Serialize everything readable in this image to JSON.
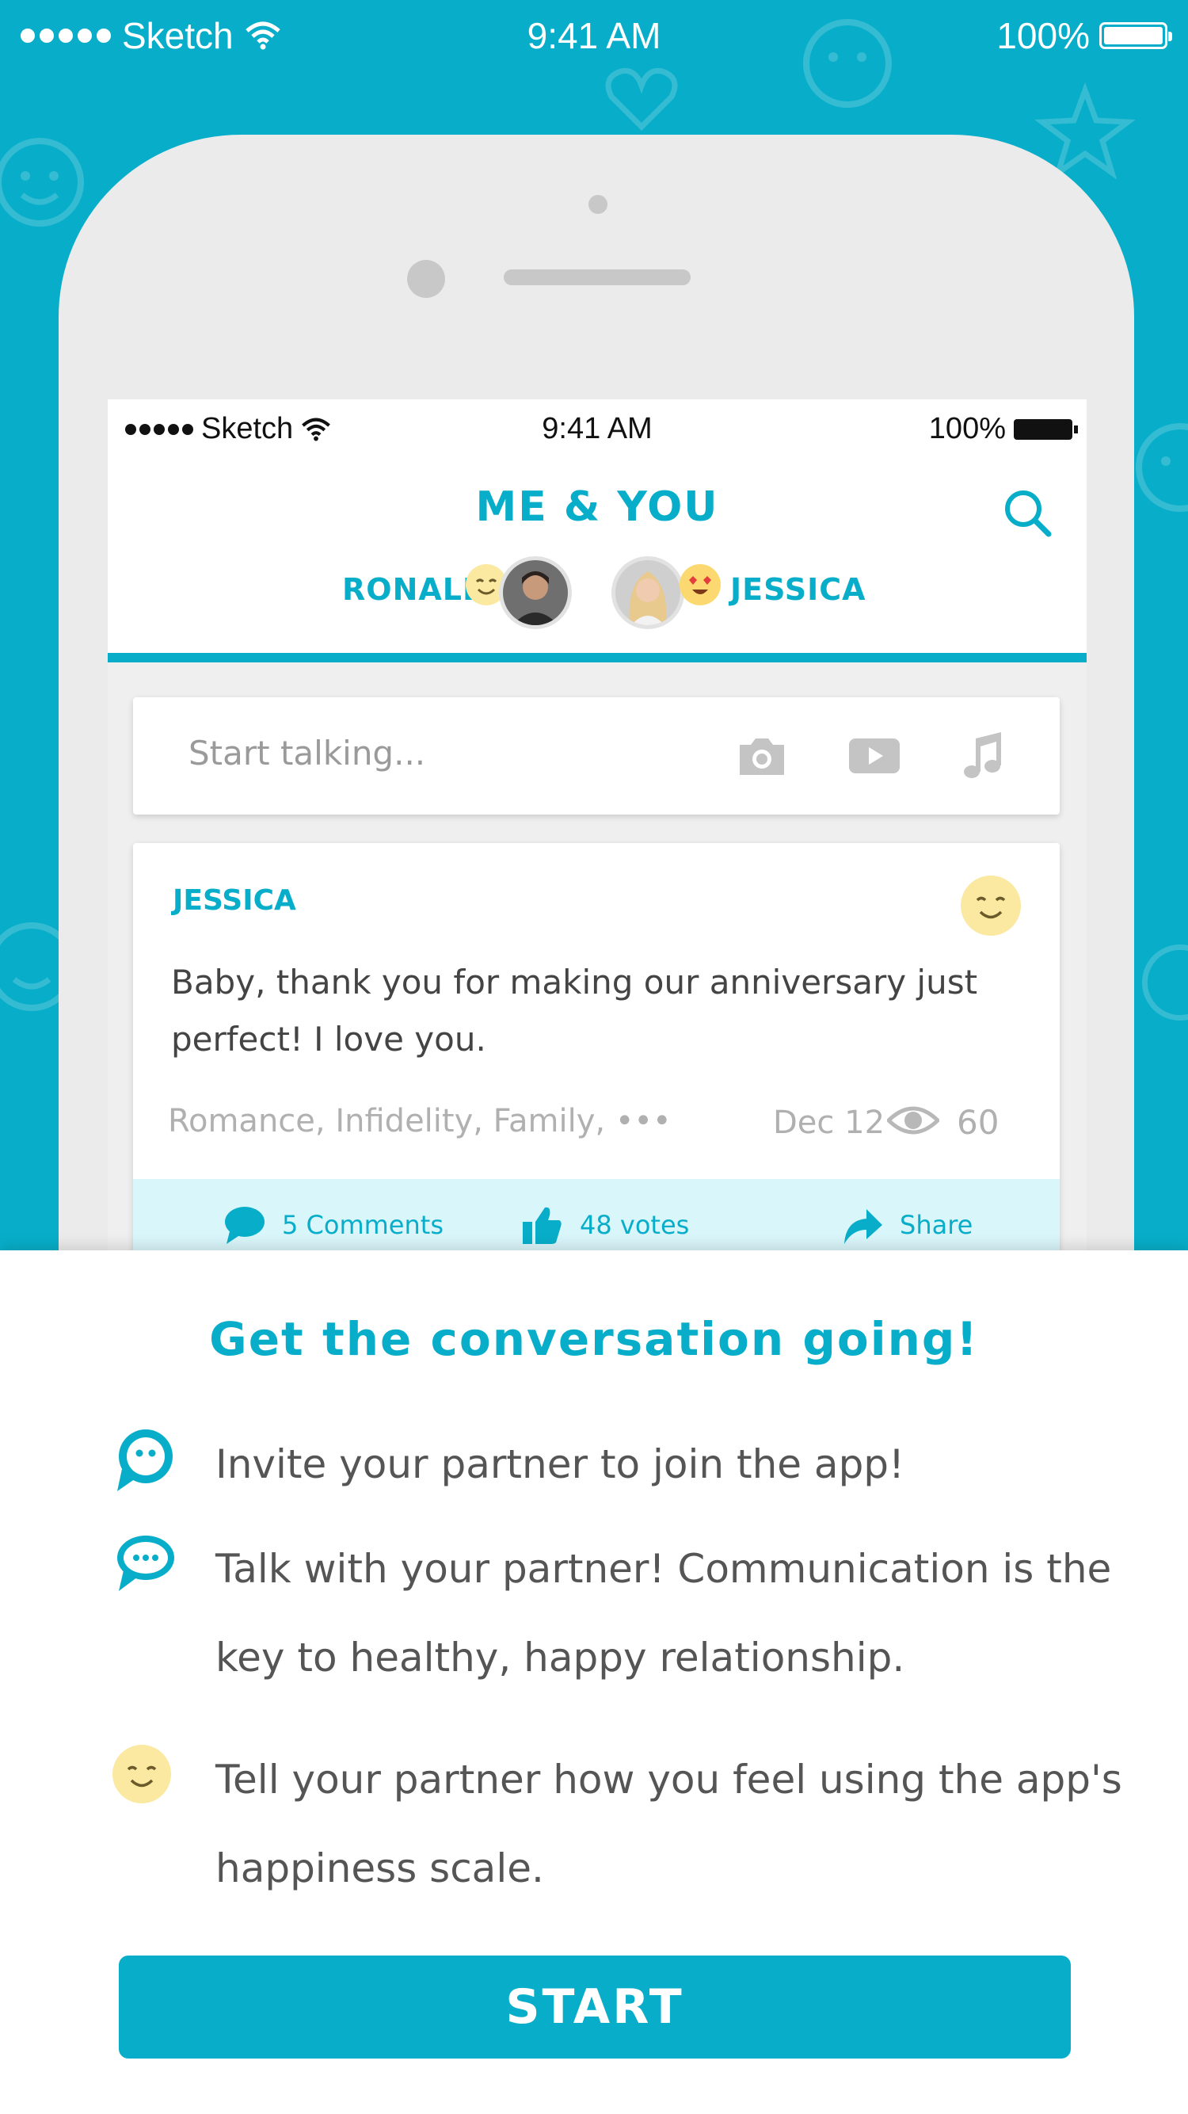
{
  "statusbar": {
    "carrier": "Sketch",
    "time": "9:41 AM",
    "battery": "100%"
  },
  "inner_statusbar": {
    "carrier": "Sketch",
    "time": "9:41 AM",
    "battery": "100%"
  },
  "app": {
    "title": "ME & YOU",
    "partner_left": "RONALD",
    "partner_right": "JESSICA"
  },
  "composer": {
    "placeholder": "Start talking..."
  },
  "post": {
    "author": "JESSICA",
    "text": "Baby, thank you for making our anniversary just perfect! I love you.",
    "tags": "Romance, Infidelity, Family, •••",
    "date": "Dec 12",
    "views": "60",
    "comments_label": "5 Comments",
    "votes_label": "48 votes",
    "share_label": "Share"
  },
  "sheet": {
    "title": "Get the conversation going!",
    "features": [
      {
        "icon": "chat-bubble-face-icon",
        "text": "Invite your partner to join the app!"
      },
      {
        "icon": "chat-bubble-dots-icon",
        "text": "Talk with your partner! Communication is the key to healthy, happy relationship."
      },
      {
        "icon": "smiley-icon",
        "text": "Tell your partner how you feel using the app's happiness scale."
      }
    ],
    "start_label": "START"
  },
  "colors": {
    "accent": "#08aec9",
    "emoji_yellow": "#fbe9a2"
  }
}
